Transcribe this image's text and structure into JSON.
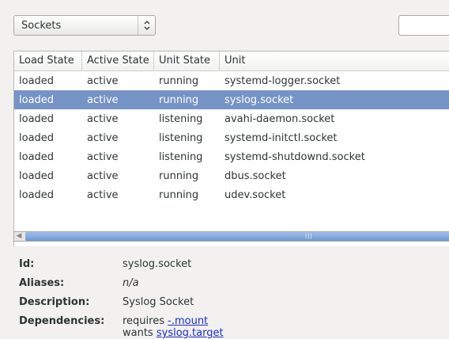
{
  "unit_type_combo": {
    "selected": "Sockets"
  },
  "search": {
    "value": ""
  },
  "table": {
    "headers": [
      "Load State",
      "Active State",
      "Unit State",
      "Unit"
    ],
    "rows": [
      {
        "load": "loaded",
        "active": "active",
        "state": "running",
        "unit": "systemd-logger.socket"
      },
      {
        "load": "loaded",
        "active": "active",
        "state": "running",
        "unit": "syslog.socket",
        "selected": true
      },
      {
        "load": "loaded",
        "active": "active",
        "state": "listening",
        "unit": "avahi-daemon.socket"
      },
      {
        "load": "loaded",
        "active": "active",
        "state": "listening",
        "unit": "systemd-initctl.socket"
      },
      {
        "load": "loaded",
        "active": "active",
        "state": "listening",
        "unit": "systemd-shutdownd.socket"
      },
      {
        "load": "loaded",
        "active": "active",
        "state": "running",
        "unit": "dbus.socket"
      },
      {
        "load": "loaded",
        "active": "active",
        "state": "running",
        "unit": "udev.socket"
      }
    ]
  },
  "details": {
    "id_label": "Id:",
    "id_value": "syslog.socket",
    "aliases_label": "Aliases:",
    "aliases_value": "n/a",
    "description_label": "Description:",
    "description_value": "Syslog Socket",
    "dependencies_label": "Dependencies:",
    "requires_text": "requires",
    "requires_link": "-.mount",
    "wants_text": "wants",
    "wants_link": "syslog.target"
  },
  "colors": {
    "selection": "#7593c5",
    "link": "#1c2fcc"
  },
  "icons": {
    "combo_arrow": "updown-chevron-icon",
    "scroll_left": "scroll-left-icon"
  }
}
